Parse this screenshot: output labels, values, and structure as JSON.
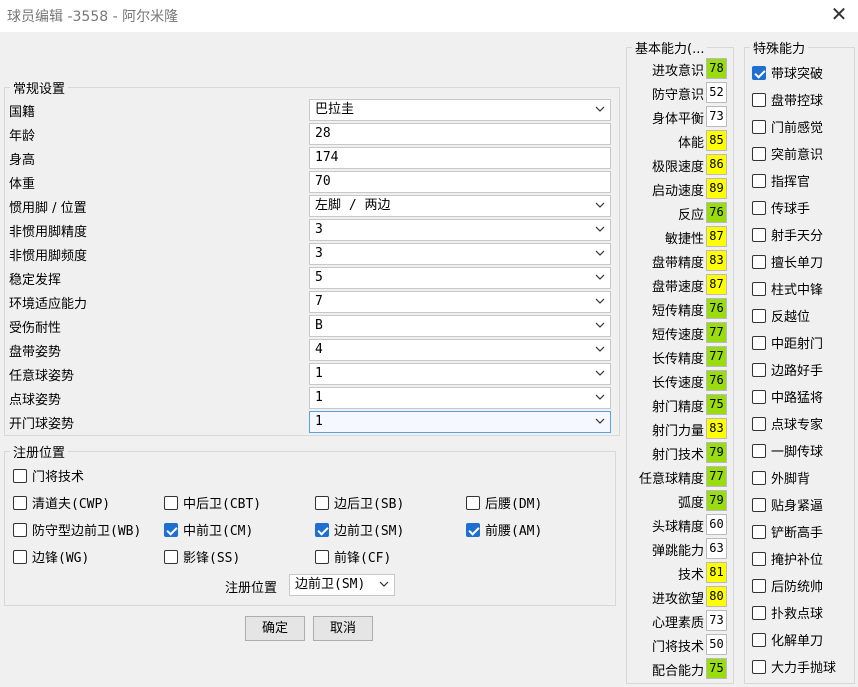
{
  "window": {
    "title": "球员编辑 -3558 - 阿尔米隆"
  },
  "general": {
    "legend": "常规设置",
    "fields": [
      {
        "label": "国籍",
        "value": "巴拉圭",
        "type": "select"
      },
      {
        "label": "年龄",
        "value": "28",
        "type": "text"
      },
      {
        "label": "身高",
        "value": "174",
        "type": "text"
      },
      {
        "label": "体重",
        "value": "70",
        "type": "text"
      },
      {
        "label": "惯用脚 / 位置",
        "value": "左脚 / 两边",
        "type": "select"
      },
      {
        "label": "非惯用脚精度",
        "value": "3",
        "type": "select"
      },
      {
        "label": "非惯用脚频度",
        "value": "3",
        "type": "select"
      },
      {
        "label": "稳定发挥",
        "value": "5",
        "type": "select"
      },
      {
        "label": "环境适应能力",
        "value": "7",
        "type": "select"
      },
      {
        "label": "受伤耐性",
        "value": "B",
        "type": "select"
      },
      {
        "label": "盘带姿势",
        "value": "4",
        "type": "select"
      },
      {
        "label": "任意球姿势",
        "value": "1",
        "type": "select"
      },
      {
        "label": "点球姿势",
        "value": "1",
        "type": "select"
      },
      {
        "label": "开门球姿势",
        "value": "1",
        "type": "select"
      }
    ]
  },
  "positions": {
    "legend": "注册位置",
    "gk": {
      "label": "门将技术",
      "checked": false
    },
    "items": [
      {
        "label": "清道夫(CWP)",
        "checked": false
      },
      {
        "label": "中后卫(CBT)",
        "checked": false
      },
      {
        "label": "边后卫(SB)",
        "checked": false
      },
      {
        "label": "后腰(DM)",
        "checked": false
      },
      {
        "label": "防守型边前卫(WB)",
        "checked": false
      },
      {
        "label": "中前卫(CM)",
        "checked": true
      },
      {
        "label": "边前卫(SM)",
        "checked": true
      },
      {
        "label": "前腰(AM)",
        "checked": true
      },
      {
        "label": "边锋(WG)",
        "checked": false
      },
      {
        "label": "影锋(SS)",
        "checked": false
      },
      {
        "label": "前锋(CF)",
        "checked": false
      }
    ],
    "registered_label": "注册位置",
    "registered_value": "边前卫(SM)"
  },
  "buttons": {
    "ok": "确定",
    "cancel": "取消"
  },
  "basic": {
    "legend": "基本能力(...",
    "stats": [
      {
        "label": "进攻意识",
        "value": "78",
        "color": "#99dd11"
      },
      {
        "label": "防守意识",
        "value": "52",
        "color": "#ffffff"
      },
      {
        "label": "身体平衡",
        "value": "73",
        "color": "#ffffff"
      },
      {
        "label": "体能",
        "value": "85",
        "color": "#ffff00"
      },
      {
        "label": "极限速度",
        "value": "86",
        "color": "#ffff00"
      },
      {
        "label": "启动速度",
        "value": "89",
        "color": "#ffff00"
      },
      {
        "label": "反应",
        "value": "76",
        "color": "#99dd11"
      },
      {
        "label": "敏捷性",
        "value": "87",
        "color": "#ffff00"
      },
      {
        "label": "盘带精度",
        "value": "83",
        "color": "#ffff00"
      },
      {
        "label": "盘带速度",
        "value": "87",
        "color": "#ffff00"
      },
      {
        "label": "短传精度",
        "value": "76",
        "color": "#99dd11"
      },
      {
        "label": "短传速度",
        "value": "77",
        "color": "#99dd11"
      },
      {
        "label": "长传精度",
        "value": "77",
        "color": "#99dd11"
      },
      {
        "label": "长传速度",
        "value": "76",
        "color": "#99dd11"
      },
      {
        "label": "射门精度",
        "value": "75",
        "color": "#99dd11"
      },
      {
        "label": "射门力量",
        "value": "83",
        "color": "#ffff00"
      },
      {
        "label": "射门技术",
        "value": "79",
        "color": "#99dd11"
      },
      {
        "label": "任意球精度",
        "value": "77",
        "color": "#99dd11"
      },
      {
        "label": "弧度",
        "value": "79",
        "color": "#99dd11"
      },
      {
        "label": "头球精度",
        "value": "60",
        "color": "#ffffff"
      },
      {
        "label": "弹跳能力",
        "value": "63",
        "color": "#ffffff"
      },
      {
        "label": "技术",
        "value": "81",
        "color": "#ffff00"
      },
      {
        "label": "进攻欲望",
        "value": "80",
        "color": "#ffff00"
      },
      {
        "label": "心理素质",
        "value": "73",
        "color": "#ffffff"
      },
      {
        "label": "门将技术",
        "value": "50",
        "color": "#ffffff"
      },
      {
        "label": "配合能力",
        "value": "75",
        "color": "#99dd11"
      }
    ]
  },
  "special": {
    "legend": "特殊能力",
    "items": [
      {
        "label": "带球突破",
        "checked": true
      },
      {
        "label": "盘带控球",
        "checked": false
      },
      {
        "label": "门前感觉",
        "checked": false
      },
      {
        "label": "突前意识",
        "checked": false
      },
      {
        "label": "指挥官",
        "checked": false
      },
      {
        "label": "传球手",
        "checked": false
      },
      {
        "label": "射手天分",
        "checked": false
      },
      {
        "label": "擅长单刀",
        "checked": false
      },
      {
        "label": "柱式中锋",
        "checked": false
      },
      {
        "label": "反越位",
        "checked": false
      },
      {
        "label": "中距射门",
        "checked": false
      },
      {
        "label": "边路好手",
        "checked": false
      },
      {
        "label": "中路猛将",
        "checked": false
      },
      {
        "label": "点球专家",
        "checked": false
      },
      {
        "label": "一脚传球",
        "checked": false
      },
      {
        "label": "外脚背",
        "checked": false
      },
      {
        "label": "贴身紧逼",
        "checked": false
      },
      {
        "label": "铲断高手",
        "checked": false
      },
      {
        "label": "掩护补位",
        "checked": false
      },
      {
        "label": "后防统帅",
        "checked": false
      },
      {
        "label": "扑救点球",
        "checked": false
      },
      {
        "label": "化解单刀",
        "checked": false
      },
      {
        "label": "大力手抛球",
        "checked": false
      }
    ]
  }
}
